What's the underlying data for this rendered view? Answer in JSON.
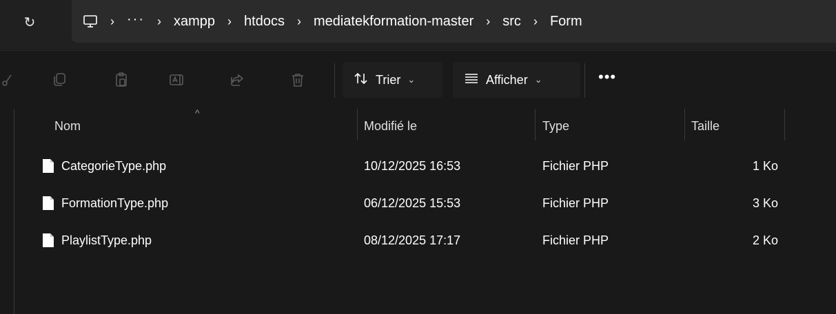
{
  "addressbar": {
    "crumbs": [
      "xampp",
      "htdocs",
      "mediatekformation-master",
      "src",
      "Form"
    ],
    "ellipsis": "···",
    "separator": "›"
  },
  "toolbar": {
    "sort_label": "Trier",
    "view_label": "Afficher",
    "more_label": "•••"
  },
  "columns": {
    "name": "Nom",
    "modified": "Modifié le",
    "type": "Type",
    "size": "Taille"
  },
  "files": [
    {
      "name": "CategorieType.php",
      "modified": "10/12/2025 16:53",
      "type": "Fichier PHP",
      "size": "1 Ko"
    },
    {
      "name": "FormationType.php",
      "modified": "06/12/2025 15:53",
      "type": "Fichier PHP",
      "size": "3 Ko"
    },
    {
      "name": "PlaylistType.php",
      "modified": "08/12/2025 17:17",
      "type": "Fichier PHP",
      "size": "2 Ko"
    }
  ]
}
